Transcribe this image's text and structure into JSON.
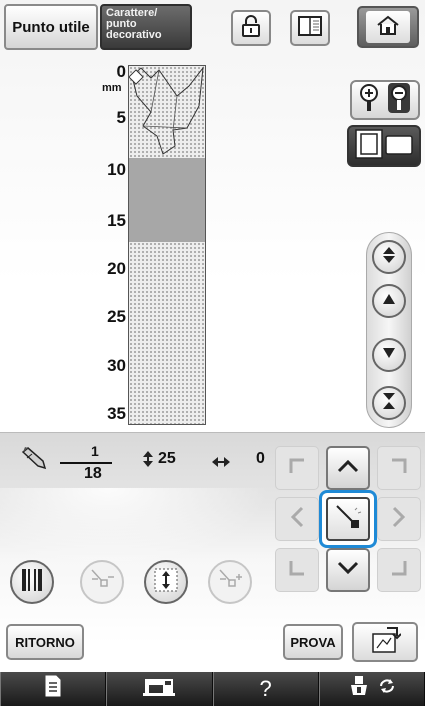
{
  "top_bar": {
    "tab_utility_label": "Punto utile",
    "tab_decorative_label": "Carattere/\npunto\ndecorativo"
  },
  "ruler": {
    "unit": "mm",
    "ticks": [
      "0",
      "5",
      "10",
      "15",
      "20",
      "25",
      "30",
      "35"
    ]
  },
  "settings": {
    "fine_adjust_numerator": "1",
    "fine_adjust_denominator": "18",
    "length_value": "25",
    "width_value": "0"
  },
  "buttons": {
    "back_label": "RITORNO",
    "test_label": "PROVA",
    "help_label": "?"
  },
  "icons": {
    "lock": "padlock-icon",
    "manual": "manual-book-icon",
    "home": "home-icon",
    "zoom": "magnifier-icon",
    "mode": "frame-mode-icon",
    "pencil": "pencil-icon",
    "length": "vertical-arrows-icon",
    "width": "horizontal-arrows-icon"
  },
  "colors": {
    "selection_highlight": "#1f8ad6",
    "decorative_tab": "#4a4a4a",
    "stitch_band": "#a7a7a7"
  }
}
